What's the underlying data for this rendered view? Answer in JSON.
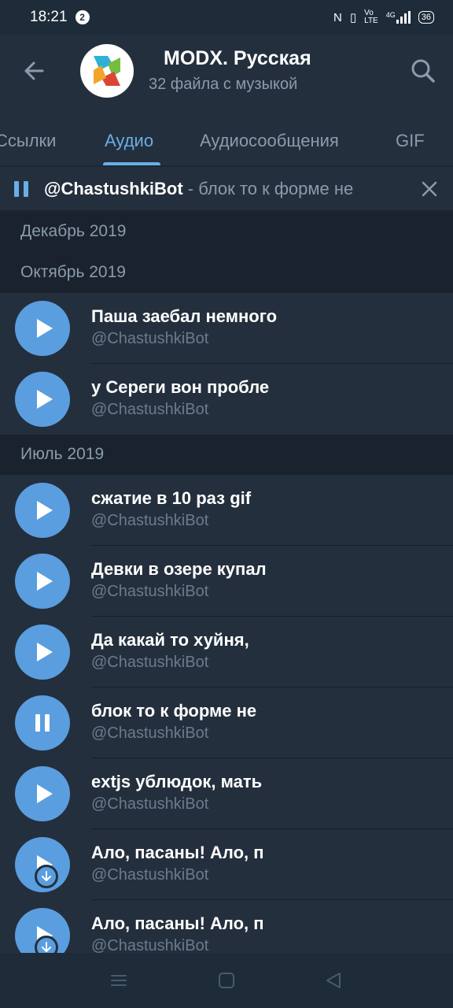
{
  "status": {
    "time": "18:21",
    "notification_count": "2",
    "network_label": "4G",
    "battery": "36",
    "icons": [
      "nfc-icon",
      "vibrate-icon",
      "volte-icon",
      "signal-icon",
      "battery-icon"
    ]
  },
  "header": {
    "title": "MODX. Русская",
    "subtitle": "32 файла с музыкой"
  },
  "tabs": [
    {
      "label": "Ссылки",
      "active": false
    },
    {
      "label": "Аудио",
      "active": true
    },
    {
      "label": "Аудиосообщения",
      "active": false
    },
    {
      "label": "GIF",
      "active": false
    }
  ],
  "player": {
    "artist": "@ChastushkiBot",
    "title": " - блок то к форме не"
  },
  "sections": [
    {
      "label": "Декабрь 2019"
    },
    {
      "label": "Октябрь 2019"
    },
    {
      "label": "Июль 2019"
    }
  ],
  "items": [
    {
      "title": "Паша заебал немного",
      "performer": "@ChastushkiBot",
      "state": "play"
    },
    {
      "title": "у Сереги вон пробле",
      "performer": "@ChastushkiBot",
      "state": "play"
    },
    {
      "title": "сжатие в 10 раз gif",
      "performer": "@ChastushkiBot",
      "state": "play"
    },
    {
      "title": "Девки в озере купал",
      "performer": "@ChastushkiBot",
      "state": "play"
    },
    {
      "title": "Да какай то хуйня,",
      "performer": "@ChastushkiBot",
      "state": "play"
    },
    {
      "title": "блок то к форме не",
      "performer": "@ChastushkiBot",
      "state": "pause"
    },
    {
      "title": "extjs ублюдок, мать",
      "performer": "@ChastushkiBot",
      "state": "play"
    },
    {
      "title": "Ало, пасаны! Ало, п",
      "performer": "@ChastushkiBot",
      "state": "play-download"
    },
    {
      "title": "Ало, пасаны! Ало, п",
      "performer": "@ChastushkiBot",
      "state": "play-download"
    }
  ],
  "colors": {
    "accent": "#6aaee8",
    "play_button": "#5a9ee0",
    "background": "#1d2733",
    "surface": "#242f3d"
  }
}
